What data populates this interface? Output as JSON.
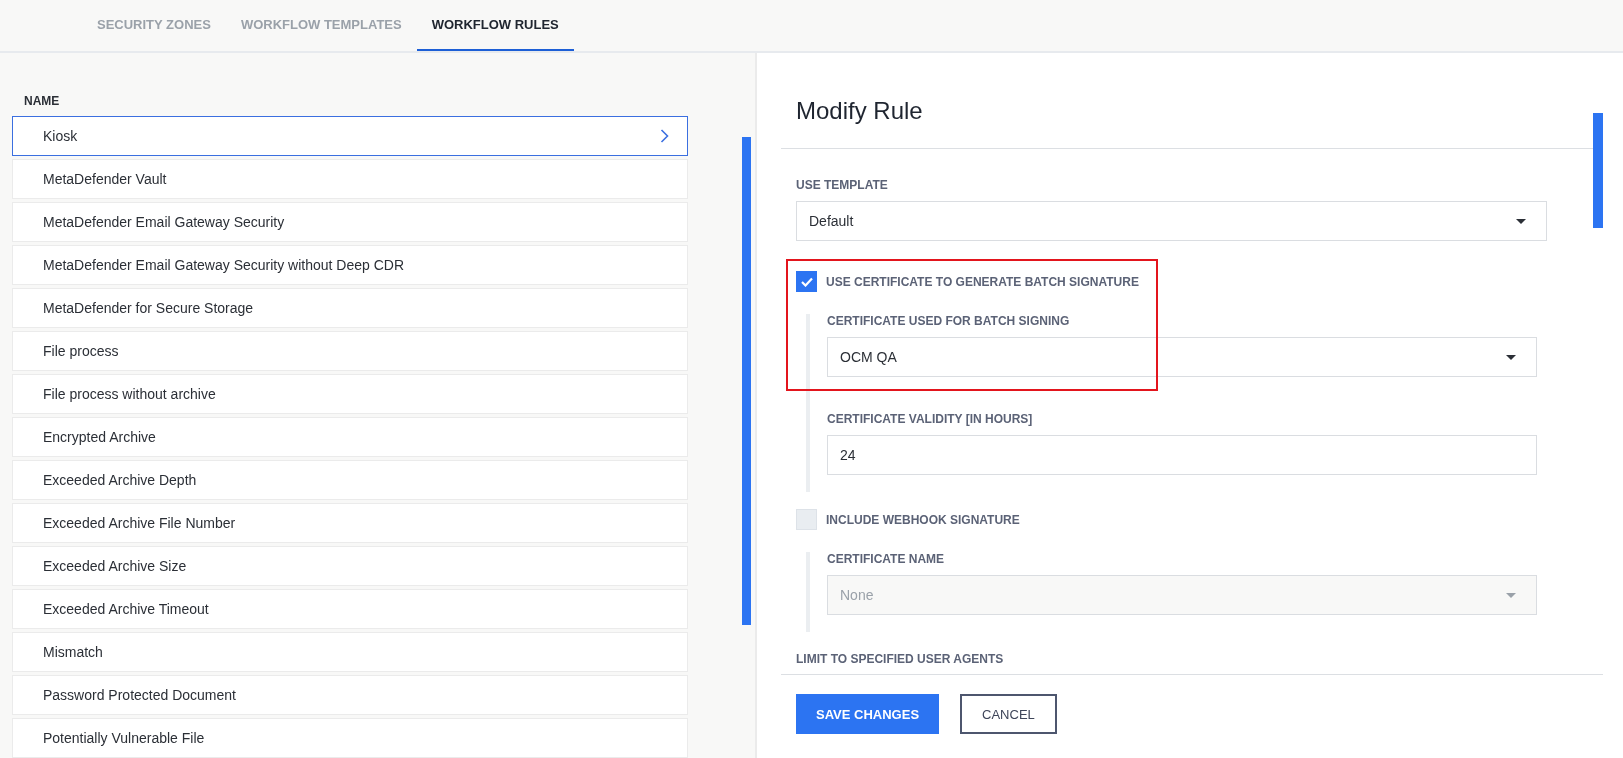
{
  "tabs": [
    {
      "label": "SECURITY ZONES",
      "selected": false
    },
    {
      "label": "WORKFLOW TEMPLATES",
      "selected": false
    },
    {
      "label": "WORKFLOW RULES",
      "selected": true
    }
  ],
  "rule_list": {
    "column_header": "NAME",
    "rows": [
      {
        "name": "Kiosk",
        "selected": true
      },
      {
        "name": "MetaDefender Vault",
        "selected": false
      },
      {
        "name": "MetaDefender Email Gateway Security",
        "selected": false
      },
      {
        "name": "MetaDefender Email Gateway Security without Deep CDR",
        "selected": false
      },
      {
        "name": "MetaDefender for Secure Storage",
        "selected": false
      },
      {
        "name": "File process",
        "selected": false
      },
      {
        "name": "File process without archive",
        "selected": false
      },
      {
        "name": "Encrypted Archive",
        "selected": false
      },
      {
        "name": "Exceeded Archive Depth",
        "selected": false
      },
      {
        "name": "Exceeded Archive File Number",
        "selected": false
      },
      {
        "name": "Exceeded Archive Size",
        "selected": false
      },
      {
        "name": "Exceeded Archive Timeout",
        "selected": false
      },
      {
        "name": "Mismatch",
        "selected": false
      },
      {
        "name": "Password Protected Document",
        "selected": false
      },
      {
        "name": "Potentially Vulnerable File",
        "selected": false
      }
    ]
  },
  "form": {
    "title": "Modify Rule",
    "fields": [
      {
        "kind": "select",
        "label": "USE TEMPLATE",
        "value": "Default",
        "disabled": false
      },
      {
        "kind": "checkbox",
        "label": "USE CERTIFICATE TO GENERATE BATCH SIGNATURE",
        "checked": true,
        "highlighted": true,
        "children": [
          {
            "kind": "select",
            "label": "CERTIFICATE USED FOR BATCH SIGNING",
            "value": "OCM QA",
            "disabled": false,
            "highlighted": true
          },
          {
            "kind": "text",
            "label": "CERTIFICATE VALIDITY [IN HOURS]",
            "value": "24"
          }
        ]
      },
      {
        "kind": "checkbox",
        "label": "INCLUDE WEBHOOK SIGNATURE",
        "checked": false,
        "children": [
          {
            "kind": "select",
            "label": "CERTIFICATE NAME",
            "value": "None",
            "disabled": true
          }
        ]
      },
      {
        "kind": "heading",
        "label": "LIMIT TO SPECIFIED USER AGENTS"
      }
    ],
    "buttons": [
      {
        "label": "SAVE CHANGES",
        "kind": "primary"
      },
      {
        "label": "CANCEL",
        "kind": "secondary"
      }
    ]
  }
}
